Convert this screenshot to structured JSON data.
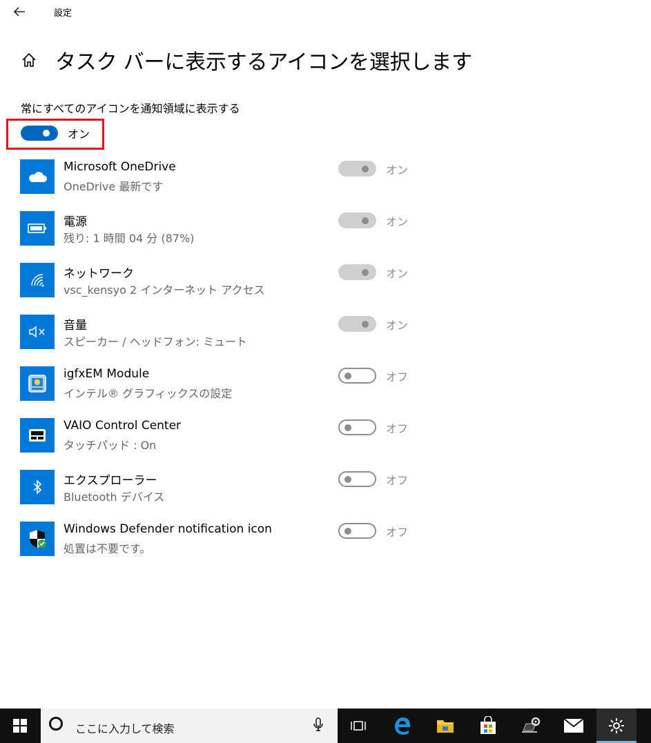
{
  "window": {
    "app_title": "設定"
  },
  "page": {
    "title": "タスク バーに表示するアイコンを選択します",
    "master_label": "常にすべてのアイコンを通知領域に表示する",
    "master_state": "オン"
  },
  "items": [
    {
      "name": "Microsoft OneDrive",
      "sub": "OneDrive 最新です",
      "state": "オン",
      "icon": "cloud-icon"
    },
    {
      "name": "電源",
      "sub": "残り: 1 時間 04 分 (87%)",
      "state": "オン",
      "icon": "battery-icon"
    },
    {
      "name": "ネットワーク",
      "sub": "vsc_kensyo 2 インターネット アクセス",
      "state": "オン",
      "icon": "wifi-icon"
    },
    {
      "name": "音量",
      "sub": "スピーカー / ヘッドフォン: ミュート",
      "state": "オン",
      "icon": "volume-mute-icon"
    },
    {
      "name": "igfxEM Module",
      "sub": "インテル® グラフィックスの設定",
      "state": "オフ",
      "icon": "intel-graphics-icon"
    },
    {
      "name": "VAIO Control Center",
      "sub": "タッチパッド : On",
      "state": "オフ",
      "icon": "touchpad-icon"
    },
    {
      "name": "エクスプローラー",
      "sub": "Bluetooth デバイス",
      "state": "オフ",
      "icon": "bluetooth-icon"
    },
    {
      "name": "Windows Defender notification icon",
      "sub": "処置は不要です。",
      "state": "オフ",
      "icon": "defender-shield-icon"
    }
  ],
  "taskbar": {
    "search_placeholder": "ここに入力して検索",
    "icons": [
      "windows-start-icon",
      "cortana-icon",
      "microphone-icon",
      "task-view-icon",
      "edge-icon",
      "file-explorer-icon",
      "store-icon",
      "laptop-settings-icon",
      "mail-icon",
      "settings-gear-icon"
    ]
  },
  "colors": {
    "accent": "#0078d7",
    "toggle_on": "#0067c0",
    "highlight_box": "#e8111b",
    "disabled": "#8d8d8d",
    "taskbar": "#101010"
  }
}
